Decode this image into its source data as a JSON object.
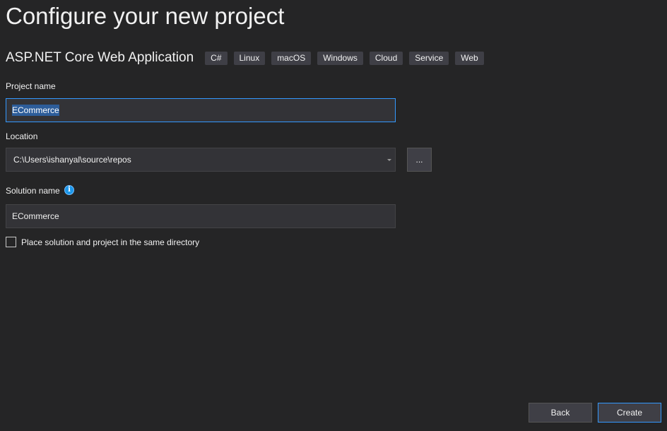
{
  "page": {
    "title": "Configure your new project"
  },
  "template": {
    "name": "ASP.NET Core Web Application",
    "tags": [
      "C#",
      "Linux",
      "macOS",
      "Windows",
      "Cloud",
      "Service",
      "Web"
    ]
  },
  "project_name": {
    "label": "Project name",
    "value": "ECommerce"
  },
  "location": {
    "label": "Location",
    "value": "C:\\Users\\ishanyal\\source\\repos",
    "browse_label": "..."
  },
  "solution_name": {
    "label": "Solution name",
    "info_glyph": "i",
    "value": "ECommerce"
  },
  "same_directory": {
    "label": "Place solution and project in the same directory",
    "checked": false
  },
  "footer": {
    "back_label": "Back",
    "create_label": "Create"
  },
  "colors": {
    "background": "#252526",
    "focus_border": "#3399ff",
    "selection": "#2d5d9a",
    "info_icon": "#1c97ea"
  },
  "icons": {
    "info": "info-icon",
    "dropdown": "chevron-down-icon"
  }
}
